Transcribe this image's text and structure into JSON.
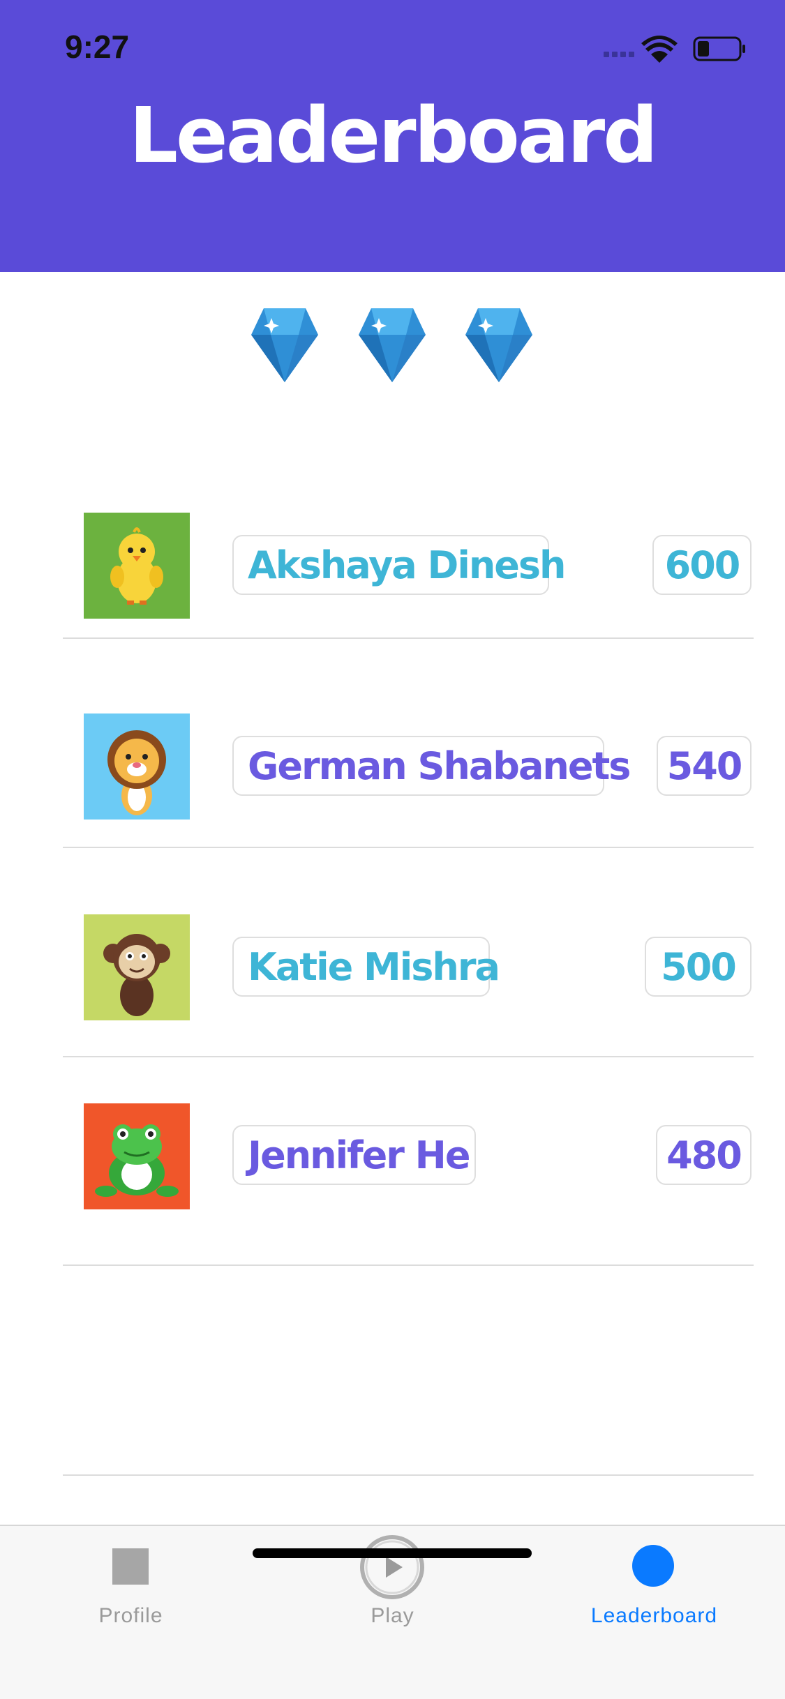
{
  "status_bar": {
    "time": "9:27"
  },
  "header": {
    "title": "Leaderboard"
  },
  "gems": [
    "diamond-icon",
    "diamond-icon",
    "diamond-icon"
  ],
  "leaderboard": {
    "entries": [
      {
        "avatar": "chick-icon",
        "avatar_bg": "#6cb23f",
        "name": "Akshaya Dinesh",
        "score": "600",
        "color": "#3eb5d6"
      },
      {
        "avatar": "lion-icon",
        "avatar_bg": "#6ccbf5",
        "name": "German Shabanets",
        "score": "540",
        "color": "#6a5ae0"
      },
      {
        "avatar": "monkey-icon",
        "avatar_bg": "#c5d865",
        "name": "Katie Mishra",
        "score": "500",
        "color": "#3eb5d6"
      },
      {
        "avatar": "frog-icon",
        "avatar_bg": "#f0562a",
        "name": "Jennifer He",
        "score": "480",
        "color": "#6a5ae0"
      }
    ]
  },
  "tabbar": {
    "tabs": [
      {
        "label": "Profile",
        "icon": "square-icon",
        "active": false
      },
      {
        "label": "Play",
        "icon": "play-icon",
        "active": false
      },
      {
        "label": "Leaderboard",
        "icon": "circle-icon",
        "active": true
      }
    ],
    "active_color": "#0a7aff",
    "inactive_color": "#9a9a9a"
  },
  "colors": {
    "header": "#5a4bd8"
  }
}
